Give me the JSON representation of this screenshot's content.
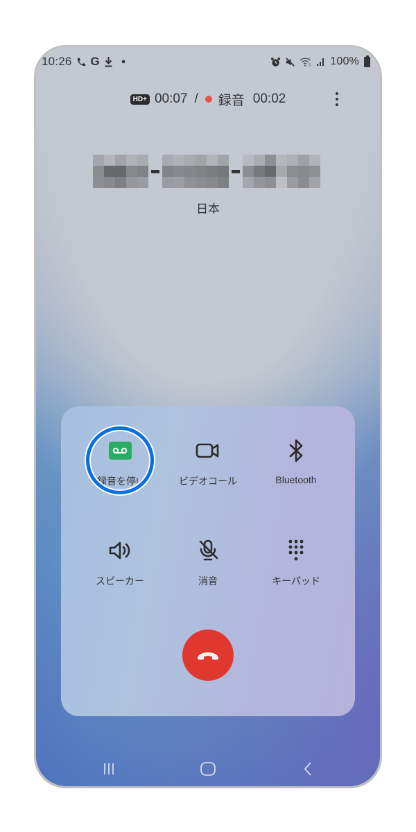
{
  "status_bar": {
    "time": "10:26",
    "left_icons": [
      "phone-call-icon",
      "google-g-icon",
      "download-icon",
      "notification-dot-icon"
    ],
    "right_icons": [
      "alarm-icon",
      "mute-icon",
      "wifi-6-icon",
      "signal-icon",
      "battery-icon"
    ],
    "g_label": "G",
    "battery_percent": "100%"
  },
  "call_header": {
    "hd_badge": "HD+",
    "call_duration": "00:07",
    "separator": "/",
    "recording_label": "録音",
    "recording_duration": "00:02",
    "recording_dot_color": "#e6524c"
  },
  "caller": {
    "number": "[pixelated phone number]",
    "location": "日本"
  },
  "controls": {
    "buttons": [
      {
        "id": "record",
        "label": "録音を停止",
        "display_label": "録音を停!",
        "icon": "voicemail-record-icon",
        "active": true,
        "icon_color": "#2cab63"
      },
      {
        "id": "video",
        "label": "ビデオコール",
        "icon": "video-camera-icon"
      },
      {
        "id": "bluetooth",
        "label": "Bluetooth",
        "icon": "bluetooth-icon"
      },
      {
        "id": "speaker",
        "label": "スピーカー",
        "icon": "speaker-icon"
      },
      {
        "id": "mute",
        "label": "消音",
        "icon": "mic-off-icon"
      },
      {
        "id": "keypad",
        "label": "キーパッド",
        "icon": "dialpad-icon"
      }
    ],
    "end_call": {
      "icon": "end-call-icon",
      "color": "#e0382e"
    }
  },
  "highlight": {
    "target": "record",
    "color": "#0a6fe0"
  },
  "nav_bar": {
    "items": [
      "recent-apps-icon",
      "home-icon",
      "back-icon"
    ]
  }
}
